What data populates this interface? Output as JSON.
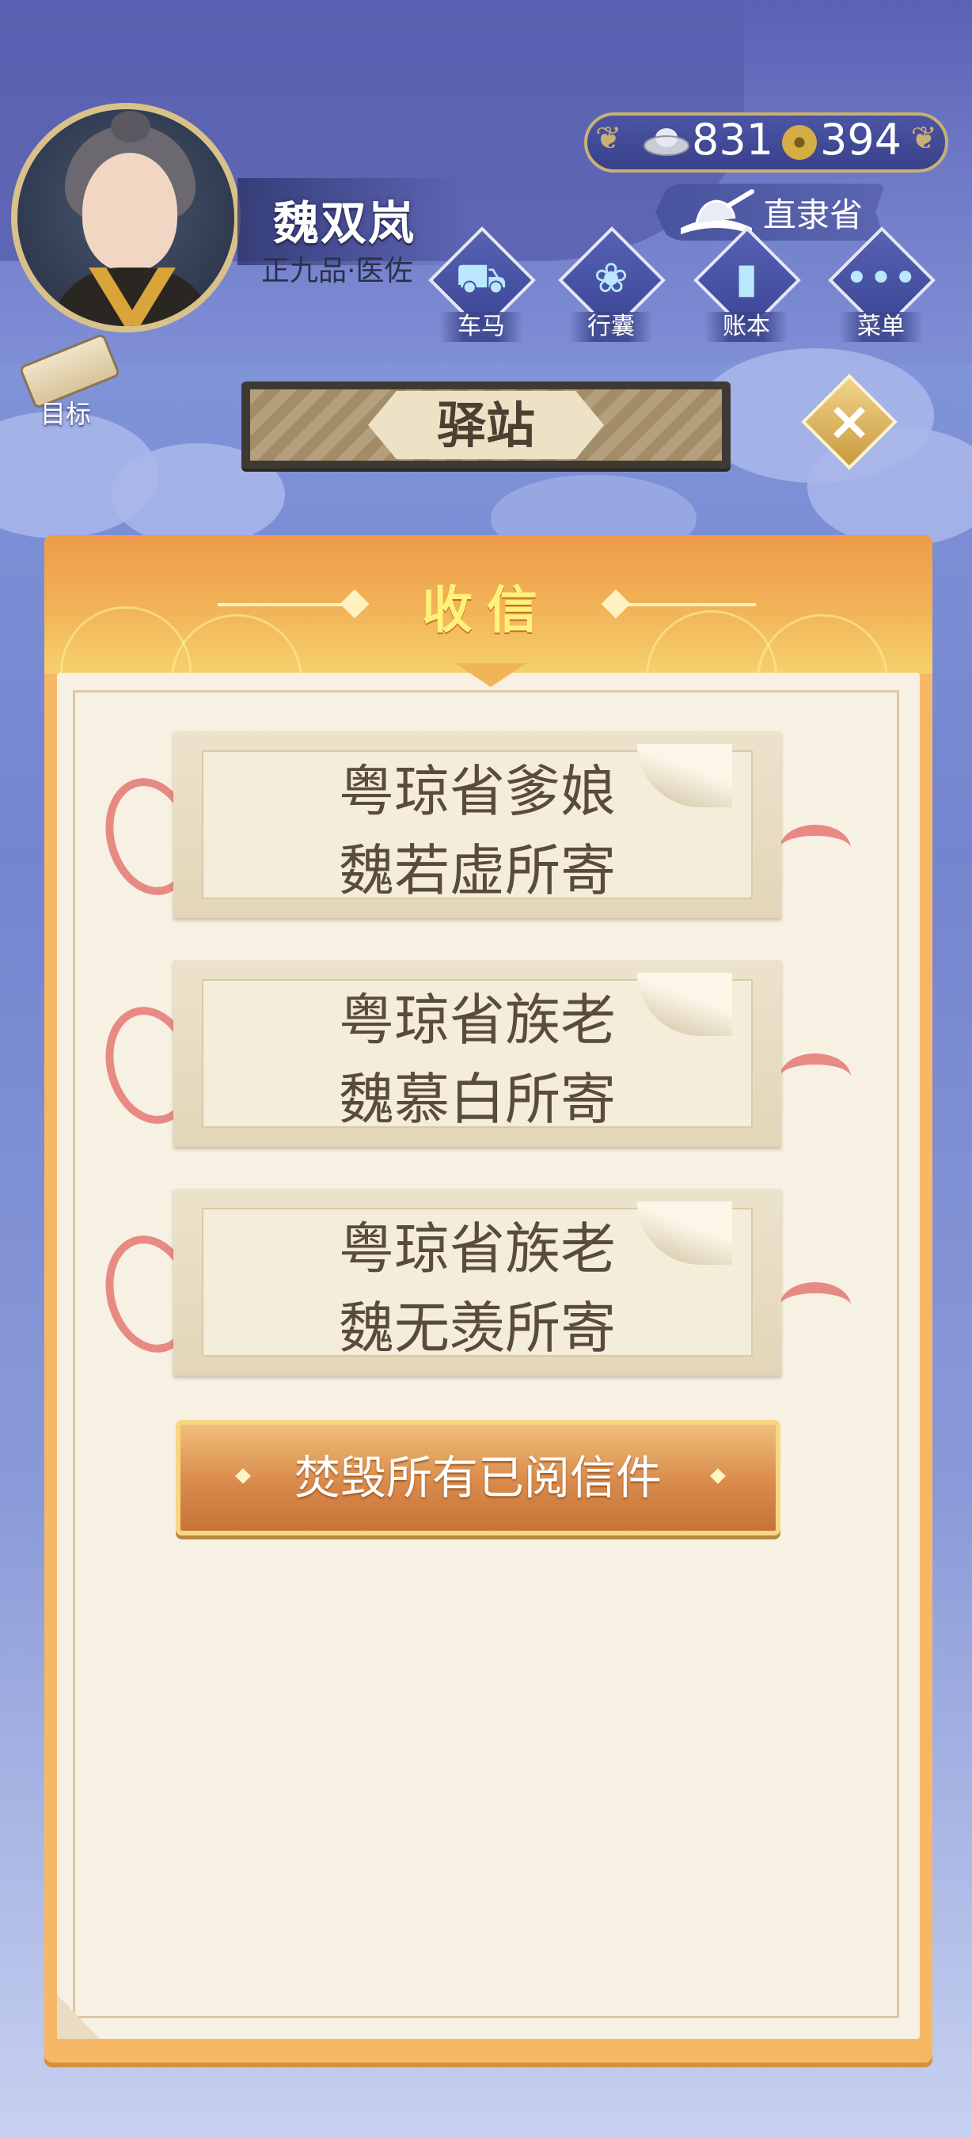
{
  "player": {
    "name": "魏双岚",
    "rank": "正九品·医佐"
  },
  "currency": {
    "silver": "831",
    "coins": "394"
  },
  "location": {
    "province": "直隶省"
  },
  "nav": [
    {
      "label": "车马",
      "icon": "carriage-icon"
    },
    {
      "label": "行囊",
      "icon": "bundle-icon"
    },
    {
      "label": "账本",
      "icon": "ledger-icon"
    },
    {
      "label": "菜单",
      "icon": "menu-dots-icon"
    }
  ],
  "goal": {
    "label": "目标"
  },
  "screen": {
    "title": "驿站"
  },
  "panel": {
    "title": "收信",
    "burn_label": "焚毁所有已阅信件"
  },
  "letters": [
    {
      "line1": "粤琼省爹娘",
      "line2": "魏若虚所寄"
    },
    {
      "line1": "粤琼省族老",
      "line2": "魏慕白所寄"
    },
    {
      "line1": "粤琼省族老",
      "line2": "魏无羡所寄"
    }
  ],
  "colors": {
    "panel_orange": "#f2b458",
    "paper": "#f7f1e3",
    "ribbon": "#e78a83",
    "title_yellow": "#fff27a"
  }
}
